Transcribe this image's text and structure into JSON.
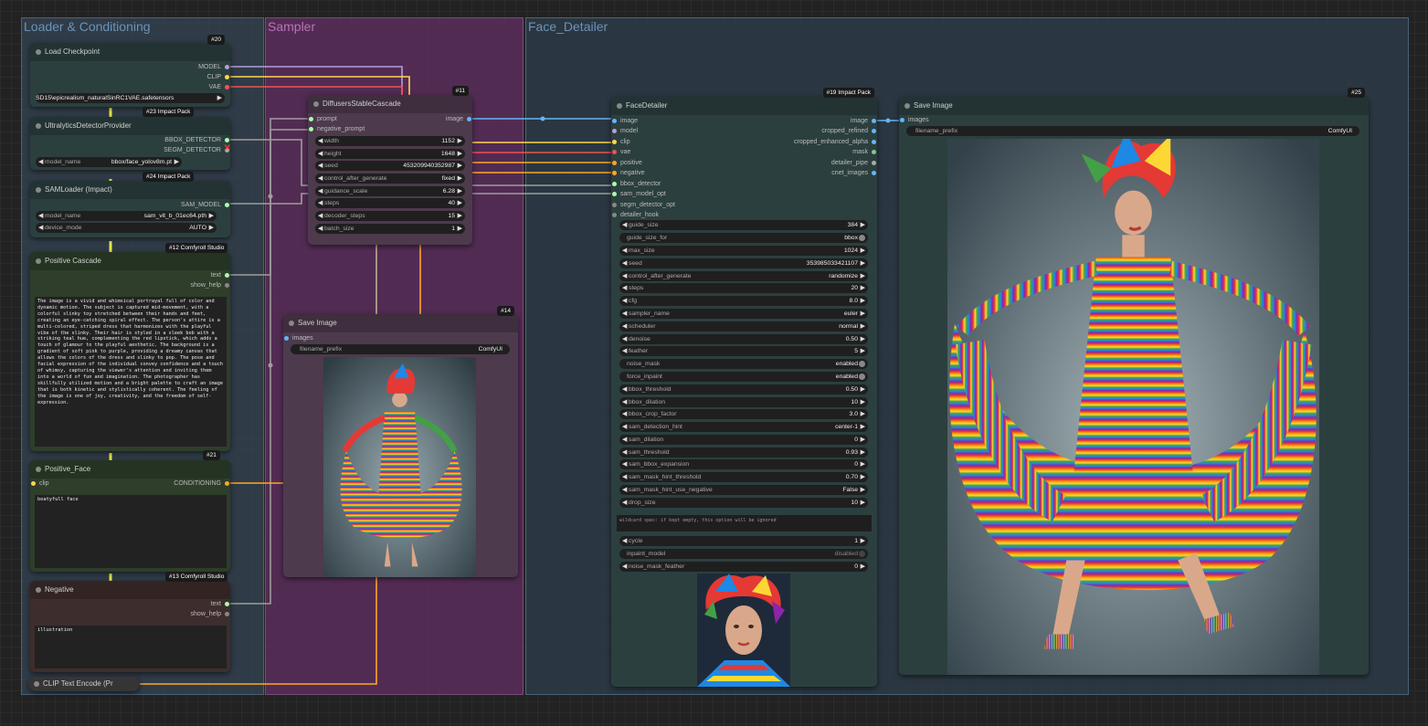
{
  "groups": [
    {
      "title": "Loader & Conditioning"
    },
    {
      "title": "Sampler"
    },
    {
      "title": "Face_Detailer"
    }
  ],
  "load_checkpoint": {
    "title": "Load Checkpoint",
    "badge": "#20",
    "outputs": [
      "MODEL",
      "CLIP",
      "VAE"
    ],
    "ckpt_value": "SD15\\epicrealism_naturalSinRC1VAE.safetensors"
  },
  "ultralytics": {
    "title": "UltralyticsDetectorProvider",
    "badge": "#23 Impact Pack",
    "outputs": [
      "BBOX_DETECTOR",
      "SEGM_DETECTOR"
    ],
    "widget_label": "model_name",
    "widget_value": "bbox/face_yolov8m.pt"
  },
  "samloader": {
    "title": "SAMLoader (Impact)",
    "badge": "#24 Impact Pack",
    "output": "SAM_MODEL",
    "widgets": [
      {
        "label": "model_name",
        "value": "sam_vit_b_01ec64.pth"
      },
      {
        "label": "device_mode",
        "value": "AUTO"
      }
    ]
  },
  "positive_cascade": {
    "title": "Positive Cascade",
    "badge": "#12 Comfyroll Studio",
    "outputs": [
      "text",
      "show_help"
    ],
    "text": "The image is a vivid and whimsical portrayal full of color and dynamic motion. The subject is captured mid-movement, with a colorful slinky toy stretched between their hands and feet, creating an eye-catching spiral effect. The person's attire is a multi-colored, striped dress that harmonizes with the playful vibe of the slinky. Their hair is styled in a sleek bob with a striking teal hue, complementing the red lipstick, which adds a touch of glamour to the playful aesthetic. The background is a gradient of soft pink to purple, providing a dreamy canvas that allows the colors of the dress and slinky to pop. The pose and facial expression of the individual convey confidence and a touch of whimsy, capturing the viewer's attention and inviting them into a world of fun and imagination. The photographer has skillfully utilized motion and a bright palette to craft an image that is both kinetic and stylistically coherent. The feeling of the image is one of joy, creativity, and the freedom of self-expression."
  },
  "positive_face": {
    "title": "Positive_Face",
    "badge": "#21",
    "input": "clip",
    "output": "CONDITIONING",
    "text": "beatyfull face"
  },
  "negative": {
    "title": "Negative",
    "badge": "#13 Comfyroll Studio",
    "outputs": [
      "text",
      "show_help"
    ],
    "text": "illustration"
  },
  "clip_encode": {
    "title": "CLIP Text Encode (Pr"
  },
  "diffusers": {
    "title": "DiffusersStableCascade",
    "badge": "#11",
    "inputs": [
      "prompt",
      "negative_prompt"
    ],
    "output": "image",
    "widgets": [
      {
        "label": "width",
        "value": "1152"
      },
      {
        "label": "height",
        "value": "1648"
      },
      {
        "label": "seed",
        "value": "453209940352987"
      },
      {
        "label": "control_after_generate",
        "value": "fixed"
      },
      {
        "label": "guidance_scale",
        "value": "6.28"
      },
      {
        "label": "steps",
        "value": "40"
      },
      {
        "label": "decoder_steps",
        "value": "15"
      },
      {
        "label": "batch_size",
        "value": "1"
      }
    ]
  },
  "save_image_small": {
    "title": "Save Image",
    "badge": "#14",
    "input": "images",
    "prefix_label": "filename_prefix",
    "prefix_value": "ComfyUI"
  },
  "face_detailer": {
    "title": "FaceDetailer",
    "badge": "#19 Impact Pack",
    "inputs": [
      "image",
      "model",
      "clip",
      "vae",
      "positive",
      "negative",
      "bbox_detector",
      "sam_model_opt",
      "segm_detector_opt",
      "detailer_hook"
    ],
    "outputs": [
      "image",
      "cropped_refined",
      "cropped_enhanced_alpha",
      "mask",
      "detailer_pipe",
      "cnet_images"
    ],
    "widgets": [
      {
        "label": "guide_size",
        "value": "384"
      },
      {
        "label": "guide_size_for",
        "value": "bbox",
        "toggle": true
      },
      {
        "label": "max_size",
        "value": "1024"
      },
      {
        "label": "seed",
        "value": "353985033421107"
      },
      {
        "label": "control_after_generate",
        "value": "randomize"
      },
      {
        "label": "steps",
        "value": "20"
      },
      {
        "label": "cfg",
        "value": "8.0"
      },
      {
        "label": "sampler_name",
        "value": "euler"
      },
      {
        "label": "scheduler",
        "value": "normal"
      },
      {
        "label": "denoise",
        "value": "0.50"
      },
      {
        "label": "feather",
        "value": "5"
      },
      {
        "label": "noise_mask",
        "value": "enabled",
        "toggle": true
      },
      {
        "label": "force_inpaint",
        "value": "enabled",
        "toggle": true
      },
      {
        "label": "bbox_threshold",
        "value": "0.50"
      },
      {
        "label": "bbox_dilation",
        "value": "10"
      },
      {
        "label": "bbox_crop_factor",
        "value": "3.0"
      },
      {
        "label": "sam_detection_hint",
        "value": "center-1"
      },
      {
        "label": "sam_dilation",
        "value": "0"
      },
      {
        "label": "sam_threshold",
        "value": "0.93"
      },
      {
        "label": "sam_bbox_expansion",
        "value": "0"
      },
      {
        "label": "sam_mask_hint_threshold",
        "value": "0.70"
      },
      {
        "label": "sam_mask_hint_use_negative",
        "value": "False"
      },
      {
        "label": "drop_size",
        "value": "10"
      }
    ],
    "wildcard_hint": "wildcard spec: if kept empty, this option will be ignored",
    "widgets2": [
      {
        "label": "cycle",
        "value": "1"
      },
      {
        "label": "inpaint_model",
        "value": "disabled",
        "toggle": true
      },
      {
        "label": "noise_mask_feather",
        "value": "0"
      }
    ]
  },
  "save_image_large": {
    "title": "Save Image",
    "badge": "#25",
    "input": "images",
    "prefix_label": "filename_prefix",
    "prefix_value": "ComfyUI"
  }
}
